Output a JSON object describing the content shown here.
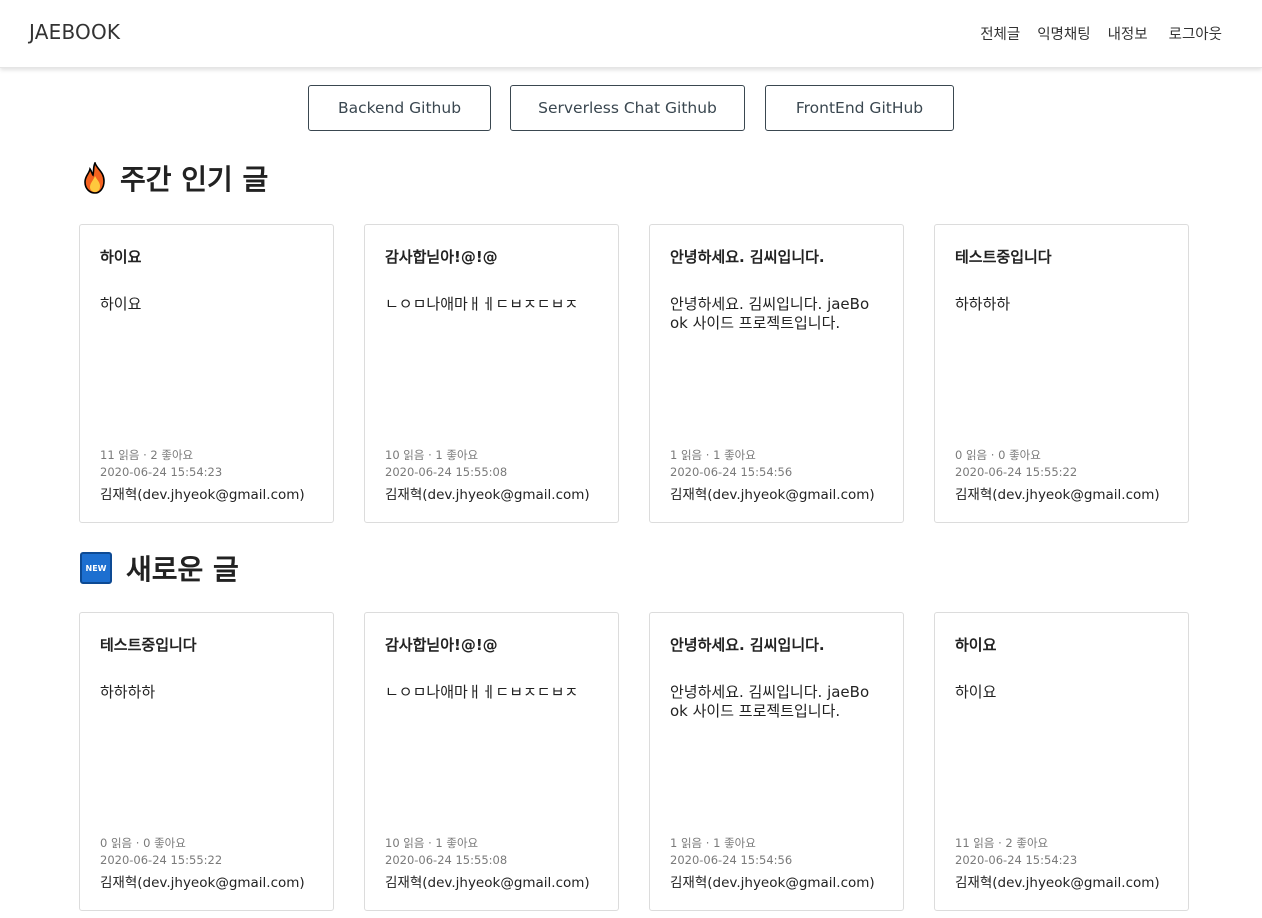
{
  "nav": {
    "brand": "JAEBOOK",
    "links": [
      "전체글",
      "익명채팅",
      "내정보",
      "로그아웃"
    ]
  },
  "github_buttons": [
    "Backend Github",
    "Serverless Chat Github",
    "FrontEnd GitHub"
  ],
  "popular": {
    "icon": "fire-icon",
    "title": "주간 인기 글",
    "cards": [
      {
        "title": "하이요",
        "body": "하이요",
        "stats": "11 읽음 · 2 좋아요",
        "date": "2020-06-24 15:54:23",
        "author": "김재혁(dev.jhyeok@gmail.com)"
      },
      {
        "title": "감사합닏아!@!@",
        "body": "ㄴㅇㅁ나애마ㅐㅔㄷㅂㅈㄷㅂㅈ",
        "stats": "10 읽음 · 1 좋아요",
        "date": "2020-06-24 15:55:08",
        "author": "김재혁(dev.jhyeok@gmail.com)"
      },
      {
        "title": "안녕하세요. 김씨입니다.",
        "body": "안녕하세요. 김씨입니다. jaeBook 사이드 프로젝트입니다.",
        "stats": "1 읽음 · 1 좋아요",
        "date": "2020-06-24 15:54:56",
        "author": "김재혁(dev.jhyeok@gmail.com)"
      },
      {
        "title": "테스트중입니다",
        "body": "하하하하",
        "stats": "0 읽음 · 0 좋아요",
        "date": "2020-06-24 15:55:22",
        "author": "김재혁(dev.jhyeok@gmail.com)"
      }
    ]
  },
  "recent": {
    "icon": "new-icon",
    "icon_text": "NEW",
    "title": "새로운 글",
    "cards": [
      {
        "title": "테스트중입니다",
        "body": "하하하하",
        "stats": "0 읽음 · 0 좋아요",
        "date": "2020-06-24 15:55:22",
        "author": "김재혁(dev.jhyeok@gmail.com)"
      },
      {
        "title": "감사합닏아!@!@",
        "body": "ㄴㅇㅁ나애마ㅐㅔㄷㅂㅈㄷㅂㅈ",
        "stats": "10 읽음 · 1 좋아요",
        "date": "2020-06-24 15:55:08",
        "author": "김재혁(dev.jhyeok@gmail.com)"
      },
      {
        "title": "안녕하세요. 김씨입니다.",
        "body": "안녕하세요. 김씨입니다. jaeBook 사이드 프로젝트입니다.",
        "stats": "1 읽음 · 1 좋아요",
        "date": "2020-06-24 15:54:56",
        "author": "김재혁(dev.jhyeok@gmail.com)"
      },
      {
        "title": "하이요",
        "body": "하이요",
        "stats": "11 읽음 · 2 좋아요",
        "date": "2020-06-24 15:54:23",
        "author": "김재혁(dev.jhyeok@gmail.com)"
      }
    ]
  },
  "colors": {
    "new_icon_bg": "#1d6fd0",
    "button_border": "#3a4750",
    "card_border": "#dcdcdc",
    "meta_text": "#7a7a7a"
  }
}
